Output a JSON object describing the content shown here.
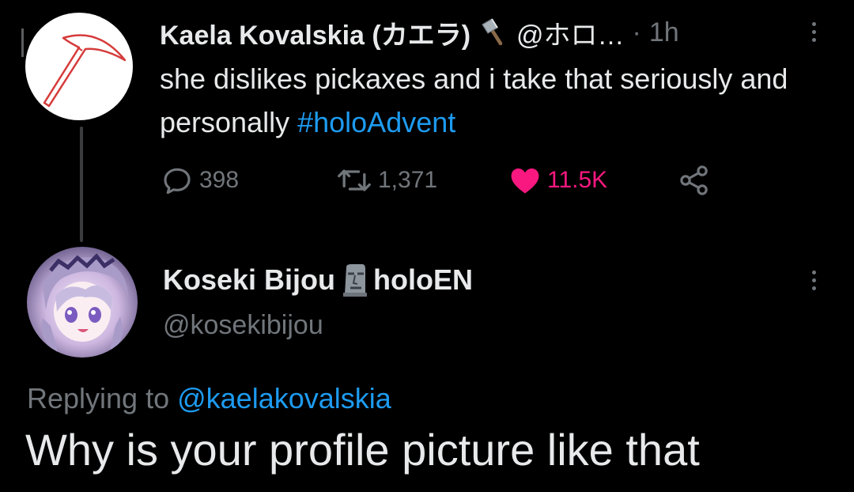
{
  "original_tweet": {
    "author_name": "Kaela Kovalskia (カエラ)",
    "handle": "@ホロ…",
    "separator": "·",
    "time": "1h",
    "text": "she dislikes pickaxes and i take that seriously and personally ",
    "hashtag": "#holoAdvent",
    "actions": {
      "replies": "398",
      "retweets": "1,371",
      "likes": "11.5K"
    },
    "avatar_icon": "pickaxe-icon",
    "name_emoji_icon": "hammer-icon"
  },
  "reply_tweet": {
    "author_name": "Koseki Bijou",
    "name_suffix": "holoEN",
    "name_emoji_icon": "moai-icon",
    "handle": "@kosekibijou",
    "replying_to_label": "Replying to ",
    "replying_to_handle": "@kaelakovalskia",
    "text": "Why is your profile picture like that"
  },
  "colors": {
    "background": "#000000",
    "text": "#e7e9ea",
    "muted": "#71767b",
    "link": "#1d9bf0",
    "like": "#f91880"
  }
}
